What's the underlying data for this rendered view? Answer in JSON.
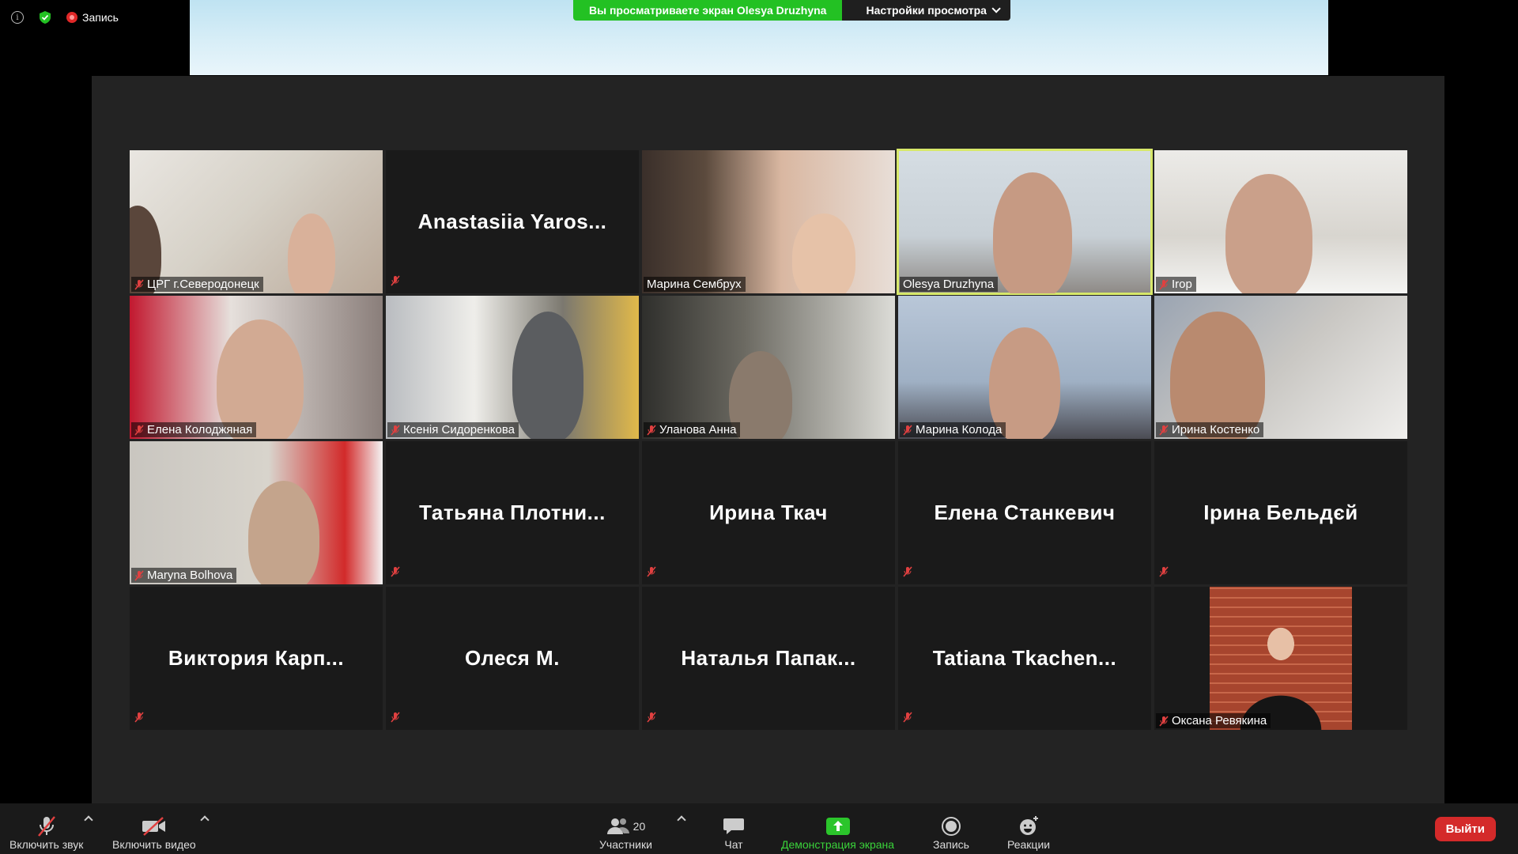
{
  "status": {
    "recording_label": "Запись"
  },
  "share_banner": {
    "viewing_text": "Вы просматриваете экран Olesya Druzhyna",
    "view_options_label": "Настройки просмотра"
  },
  "tiles": [
    {
      "name": "ЦРГ г.Северодонецк",
      "video": true,
      "muted": true
    },
    {
      "name": "Anastasiia  Yaros...",
      "video": false,
      "muted": true
    },
    {
      "name": "Марина Сембрух",
      "video": true,
      "muted": false
    },
    {
      "name": "Olesya Druzhyna",
      "video": true,
      "muted": false,
      "active_speaker": true
    },
    {
      "name": "Irop",
      "video": true,
      "muted": true
    },
    {
      "name": "Елена Колоджяная",
      "video": true,
      "muted": true
    },
    {
      "name": "Ксенія Сидоренкова",
      "video": true,
      "muted": true
    },
    {
      "name": "Уланова Анна",
      "video": true,
      "muted": true
    },
    {
      "name": "Марина Колода",
      "video": true,
      "muted": true
    },
    {
      "name": "Ирина Костенко",
      "video": true,
      "muted": true
    },
    {
      "name": "Maryna Bolhova",
      "video": true,
      "muted": true
    },
    {
      "name": "Татьяна  Плотни...",
      "video": false,
      "muted": true
    },
    {
      "name": "Ирина Ткач",
      "video": false,
      "muted": true
    },
    {
      "name": "Елена Станкевич",
      "video": false,
      "muted": true
    },
    {
      "name": "Ірина Бельдєй",
      "video": false,
      "muted": true
    },
    {
      "name": "Виктория  Карп...",
      "video": false,
      "muted": true
    },
    {
      "name": "Олеся М.",
      "video": false,
      "muted": true
    },
    {
      "name": "Наталья  Папак...",
      "video": false,
      "muted": true
    },
    {
      "name": "Tatiana  Tkachen...",
      "video": false,
      "muted": true
    },
    {
      "name": "Оксана Ревякина",
      "video": true,
      "muted": true,
      "profile_photo": true
    }
  ],
  "toolbar": {
    "mute_label": "Включить звук",
    "video_label": "Включить видео",
    "participants_label": "Участники",
    "participants_count": "20",
    "chat_label": "Чат",
    "share_label": "Демонстрация экрана",
    "record_label": "Запись",
    "reactions_label": "Реакции",
    "leave_label": "Выйти"
  },
  "colors": {
    "share_green": "#23c123",
    "active_speaker_border": "#d7e86a",
    "leave_red": "#d42a2a",
    "muted_red": "#e04040"
  }
}
